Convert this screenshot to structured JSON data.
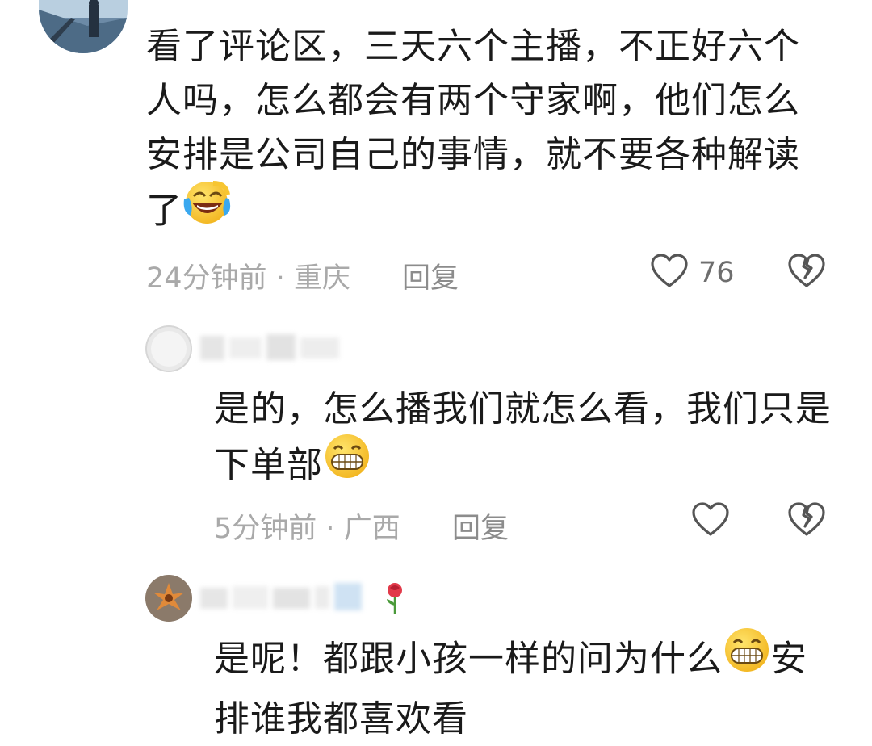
{
  "comments": [
    {
      "text_lines": [
        "看了评论区，三天六个主播，不正好六个",
        "人吗，怎么都会有两个守家啊，他们怎么",
        "安排是公司自己的事情，就不要各种解读",
        "了"
      ],
      "time": "24分钟前",
      "location": "重庆",
      "reply_label": "回复",
      "like_count": "76",
      "like_icon": "heart-outline-icon",
      "dislike_icon": "broken-heart-icon"
    },
    {
      "text_lines": [
        "是的，怎么播我们就怎么看，我们只是",
        "下单部"
      ],
      "time": "5分钟前",
      "location": "广西",
      "reply_label": "回复",
      "like_icon": "heart-outline-icon",
      "dislike_icon": "broken-heart-icon"
    },
    {
      "text_lines": [
        "是呢！都跟小孩一样的问为什么",
        "安",
        "排谁我都喜欢看"
      ]
    }
  ],
  "meta_separator": "·",
  "emojis": [
    "laughing-crying-emoji",
    "grinning-emoji",
    "grinning-emoji"
  ],
  "colors": {
    "text": "#1a1a1a",
    "meta": "#a9a9a9",
    "reply": "#8c8c8c",
    "emoji_yellow": "#f7c531",
    "tear_blue": "#3aa8ef"
  }
}
